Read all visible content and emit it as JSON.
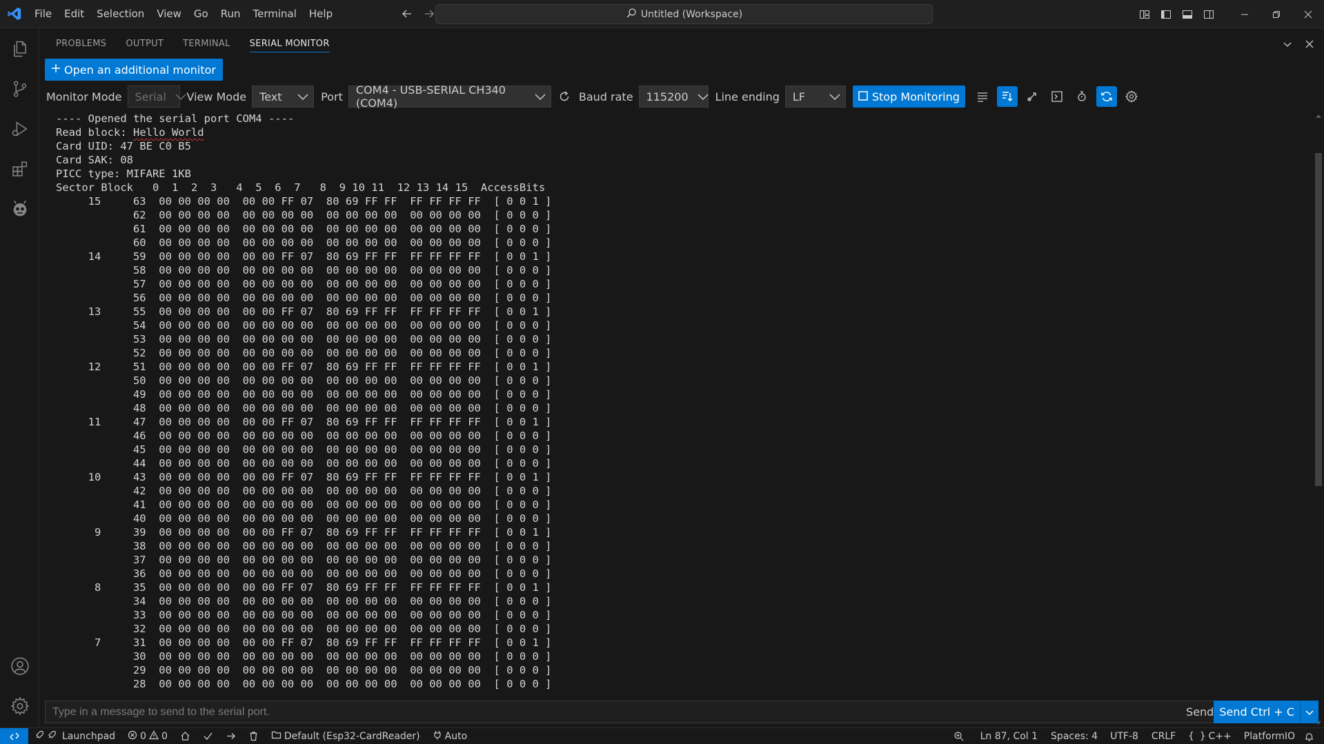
{
  "titlebar": {
    "menu": [
      "File",
      "Edit",
      "Selection",
      "View",
      "Go",
      "Run",
      "Terminal",
      "Help"
    ],
    "workspace_title": "Untitled (Workspace)"
  },
  "panel": {
    "tabs": [
      "PROBLEMS",
      "OUTPUT",
      "TERMINAL",
      "SERIAL MONITOR"
    ],
    "active_tab": "SERIAL MONITOR"
  },
  "serial": {
    "open_monitor_label": "Open an additional monitor",
    "monitor_mode_label": "Monitor Mode",
    "monitor_mode_value": "Serial",
    "view_mode_label": "View Mode",
    "view_mode_value": "Text",
    "port_label": "Port",
    "port_value": "COM4 - USB-SERIAL CH340 (COM4)",
    "baud_label": "Baud rate",
    "baud_value": "115200",
    "line_ending_label": "Line ending",
    "line_ending_value": "LF",
    "stop_label": "Stop Monitoring",
    "header_lines": [
      "---- Opened the serial port COM4 ----",
      "Card UID: 47 BE C0 B5",
      "Card SAK: 08",
      "PICC type: MIFARE 1KB",
      "Sector Block   0  1  2  3   4  5  6  7   8  9 10 11  12 13 14 15  AccessBits"
    ],
    "read_block_prefix": "Read block: ",
    "read_block_value": "Hello World",
    "blocks": [
      {
        "sector": "15",
        "block": "63",
        "data": "00 00 00 00  00 00 FF 07  80 69 FF FF  FF FF FF FF",
        "access": "[ 0 0 1 ]"
      },
      {
        "sector": "",
        "block": "62",
        "data": "00 00 00 00  00 00 00 00  00 00 00 00  00 00 00 00",
        "access": "[ 0 0 0 ]"
      },
      {
        "sector": "",
        "block": "61",
        "data": "00 00 00 00  00 00 00 00  00 00 00 00  00 00 00 00",
        "access": "[ 0 0 0 ]"
      },
      {
        "sector": "",
        "block": "60",
        "data": "00 00 00 00  00 00 00 00  00 00 00 00  00 00 00 00",
        "access": "[ 0 0 0 ]"
      },
      {
        "sector": "14",
        "block": "59",
        "data": "00 00 00 00  00 00 FF 07  80 69 FF FF  FF FF FF FF",
        "access": "[ 0 0 1 ]"
      },
      {
        "sector": "",
        "block": "58",
        "data": "00 00 00 00  00 00 00 00  00 00 00 00  00 00 00 00",
        "access": "[ 0 0 0 ]"
      },
      {
        "sector": "",
        "block": "57",
        "data": "00 00 00 00  00 00 00 00  00 00 00 00  00 00 00 00",
        "access": "[ 0 0 0 ]"
      },
      {
        "sector": "",
        "block": "56",
        "data": "00 00 00 00  00 00 00 00  00 00 00 00  00 00 00 00",
        "access": "[ 0 0 0 ]"
      },
      {
        "sector": "13",
        "block": "55",
        "data": "00 00 00 00  00 00 FF 07  80 69 FF FF  FF FF FF FF",
        "access": "[ 0 0 1 ]"
      },
      {
        "sector": "",
        "block": "54",
        "data": "00 00 00 00  00 00 00 00  00 00 00 00  00 00 00 00",
        "access": "[ 0 0 0 ]"
      },
      {
        "sector": "",
        "block": "53",
        "data": "00 00 00 00  00 00 00 00  00 00 00 00  00 00 00 00",
        "access": "[ 0 0 0 ]"
      },
      {
        "sector": "",
        "block": "52",
        "data": "00 00 00 00  00 00 00 00  00 00 00 00  00 00 00 00",
        "access": "[ 0 0 0 ]"
      },
      {
        "sector": "12",
        "block": "51",
        "data": "00 00 00 00  00 00 FF 07  80 69 FF FF  FF FF FF FF",
        "access": "[ 0 0 1 ]"
      },
      {
        "sector": "",
        "block": "50",
        "data": "00 00 00 00  00 00 00 00  00 00 00 00  00 00 00 00",
        "access": "[ 0 0 0 ]"
      },
      {
        "sector": "",
        "block": "49",
        "data": "00 00 00 00  00 00 00 00  00 00 00 00  00 00 00 00",
        "access": "[ 0 0 0 ]"
      },
      {
        "sector": "",
        "block": "48",
        "data": "00 00 00 00  00 00 00 00  00 00 00 00  00 00 00 00",
        "access": "[ 0 0 0 ]"
      },
      {
        "sector": "11",
        "block": "47",
        "data": "00 00 00 00  00 00 FF 07  80 69 FF FF  FF FF FF FF",
        "access": "[ 0 0 1 ]"
      },
      {
        "sector": "",
        "block": "46",
        "data": "00 00 00 00  00 00 00 00  00 00 00 00  00 00 00 00",
        "access": "[ 0 0 0 ]"
      },
      {
        "sector": "",
        "block": "45",
        "data": "00 00 00 00  00 00 00 00  00 00 00 00  00 00 00 00",
        "access": "[ 0 0 0 ]"
      },
      {
        "sector": "",
        "block": "44",
        "data": "00 00 00 00  00 00 00 00  00 00 00 00  00 00 00 00",
        "access": "[ 0 0 0 ]"
      },
      {
        "sector": "10",
        "block": "43",
        "data": "00 00 00 00  00 00 FF 07  80 69 FF FF  FF FF FF FF",
        "access": "[ 0 0 1 ]"
      },
      {
        "sector": "",
        "block": "42",
        "data": "00 00 00 00  00 00 00 00  00 00 00 00  00 00 00 00",
        "access": "[ 0 0 0 ]"
      },
      {
        "sector": "",
        "block": "41",
        "data": "00 00 00 00  00 00 00 00  00 00 00 00  00 00 00 00",
        "access": "[ 0 0 0 ]"
      },
      {
        "sector": "",
        "block": "40",
        "data": "00 00 00 00  00 00 00 00  00 00 00 00  00 00 00 00",
        "access": "[ 0 0 0 ]"
      },
      {
        "sector": "9",
        "block": "39",
        "data": "00 00 00 00  00 00 FF 07  80 69 FF FF  FF FF FF FF",
        "access": "[ 0 0 1 ]"
      },
      {
        "sector": "",
        "block": "38",
        "data": "00 00 00 00  00 00 00 00  00 00 00 00  00 00 00 00",
        "access": "[ 0 0 0 ]"
      },
      {
        "sector": "",
        "block": "37",
        "data": "00 00 00 00  00 00 00 00  00 00 00 00  00 00 00 00",
        "access": "[ 0 0 0 ]"
      },
      {
        "sector": "",
        "block": "36",
        "data": "00 00 00 00  00 00 00 00  00 00 00 00  00 00 00 00",
        "access": "[ 0 0 0 ]"
      },
      {
        "sector": "8",
        "block": "35",
        "data": "00 00 00 00  00 00 FF 07  80 69 FF FF  FF FF FF FF",
        "access": "[ 0 0 1 ]"
      },
      {
        "sector": "",
        "block": "34",
        "data": "00 00 00 00  00 00 00 00  00 00 00 00  00 00 00 00",
        "access": "[ 0 0 0 ]"
      },
      {
        "sector": "",
        "block": "33",
        "data": "00 00 00 00  00 00 00 00  00 00 00 00  00 00 00 00",
        "access": "[ 0 0 0 ]"
      },
      {
        "sector": "",
        "block": "32",
        "data": "00 00 00 00  00 00 00 00  00 00 00 00  00 00 00 00",
        "access": "[ 0 0 0 ]"
      },
      {
        "sector": "7",
        "block": "31",
        "data": "00 00 00 00  00 00 FF 07  80 69 FF FF  FF FF FF FF",
        "access": "[ 0 0 1 ]"
      },
      {
        "sector": "",
        "block": "30",
        "data": "00 00 00 00  00 00 00 00  00 00 00 00  00 00 00 00",
        "access": "[ 0 0 0 ]"
      },
      {
        "sector": "",
        "block": "29",
        "data": "00 00 00 00  00 00 00 00  00 00 00 00  00 00 00 00",
        "access": "[ 0 0 0 ]"
      },
      {
        "sector": "",
        "block": "28",
        "data": "00 00 00 00  00 00 00 00  00 00 00 00  00 00 00 00",
        "access": "[ 0 0 0 ]"
      }
    ],
    "input_placeholder": "Type in a message to send to the serial port.",
    "send_as_label": "Send as Text",
    "send_ctrl_label": "Send Ctrl + C"
  },
  "statusbar": {
    "launchpad": "Launchpad",
    "errors": "0",
    "warnings": "0",
    "env": "Default (Esp32-CardReader)",
    "auto": "Auto",
    "position": "Ln 87, Col 1",
    "spaces": "Spaces: 4",
    "encoding": "UTF-8",
    "eol": "CRLF",
    "language": "C++",
    "platformio": "PlatformIO"
  },
  "colors": {
    "accent": "#0078d4",
    "background": "#181818",
    "spell_error": "#d13438"
  },
  "icons": {
    "activity": [
      "explorer-icon",
      "source-control-icon",
      "run-debug-icon",
      "extensions-icon",
      "platformio-icon",
      "account-icon",
      "manage-gear-icon"
    ]
  }
}
